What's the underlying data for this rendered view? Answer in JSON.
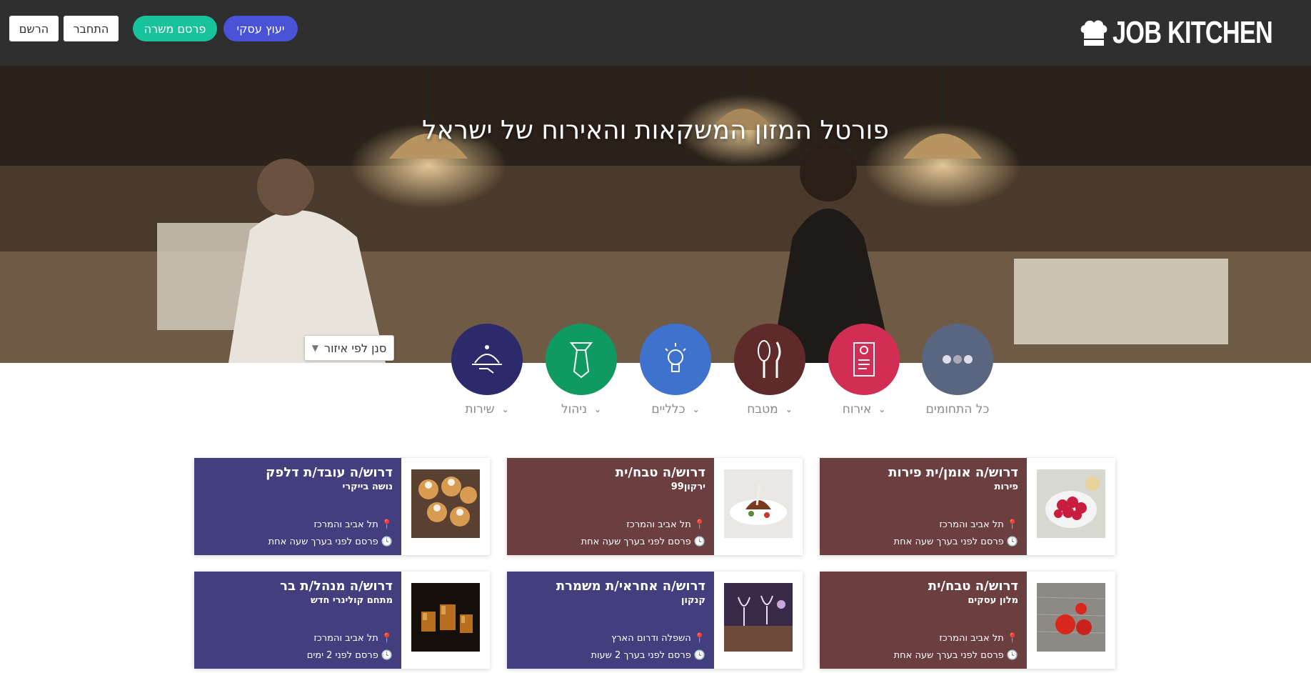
{
  "header": {
    "logo_text": "JOB KITCHEN",
    "buttons": {
      "advisor": "יעוץ עסקי",
      "post_job": "פרסם משרה",
      "login": "התחבר",
      "register": "הרשם"
    }
  },
  "hero": {
    "title": "פורטל המזון המשקאות והאירוח של ישראל"
  },
  "region_filter": {
    "label": "סנן לפי איזור"
  },
  "categories": [
    {
      "label": "כל התחומים",
      "icon": "dots-icon",
      "color": "#5a6680"
    },
    {
      "label": "אירוח",
      "icon": "door-hanger-icon",
      "color": "#d22e55"
    },
    {
      "label": "מטבח",
      "icon": "whisk-knife-icon",
      "color": "#5e2a2a"
    },
    {
      "label": "כלליים",
      "icon": "lightbulb-icon",
      "color": "#3f72cc"
    },
    {
      "label": "ניהול",
      "icon": "tie-icon",
      "color": "#0f9a61"
    },
    {
      "label": "שירות",
      "icon": "serving-tray-icon",
      "color": "#2c2a6b"
    }
  ],
  "jobs": [
    {
      "title": "דרוש/ה אומן/ית פירות",
      "company": "פירות",
      "location": "תל אביב והמרכז",
      "posted": "פרסם לפני בערך שעה אחת",
      "color": "#6b3e40",
      "image": "raspberries"
    },
    {
      "title": "דרוש/ה טבח/ית",
      "company": "ירקון99",
      "location": "תל אביב והמרכז",
      "posted": "פרסם לפני בערך שעה אחת",
      "color": "#6b3e40",
      "image": "plated-dish"
    },
    {
      "title": "דרוש/ה עובד/ת דלפק",
      "company": "נושה בייקרי",
      "location": "תל אביב והמרכז",
      "posted": "פרסם לפני בערך שעה אחת",
      "color": "#433f7e",
      "image": "pastries"
    },
    {
      "title": "דרוש/ה טבח/ית",
      "company": "מלון עסקים",
      "location": "תל אביב והמרכז",
      "posted": "פרסם לפני בערך שעה אחת",
      "color": "#6b3e40",
      "image": "tomatoes"
    },
    {
      "title": "דרוש/ה אחראי/ת משמרת",
      "company": "קנקון",
      "location": "השפלה ודרום הארץ",
      "posted": "פרסם לפני בערך 2 שעות",
      "color": "#433f7e",
      "image": "wine-glasses"
    },
    {
      "title": "דרוש/ה מנהל/ת בר",
      "company": "מתחם קולינרי חדש",
      "location": "תל אביב והמרכז",
      "posted": "פרסם לפני 2 ימים",
      "color": "#433f7e",
      "image": "cocktails"
    }
  ]
}
